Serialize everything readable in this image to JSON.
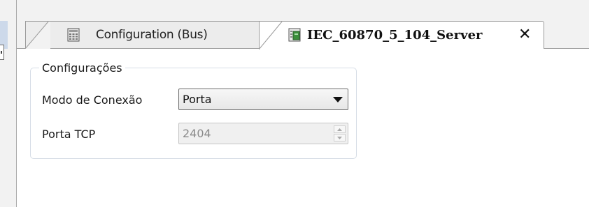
{
  "tabs": [
    {
      "label": "Configuration (Bus)",
      "icon": "device-config-icon",
      "active": false
    },
    {
      "label": "IEC_60870_5_104_Server",
      "icon": "server-object-icon",
      "active": true,
      "close": "✕"
    }
  ],
  "settings": {
    "group_title": "Configurações",
    "connection_mode": {
      "label": "Modo de Conexão",
      "value": "Porta"
    },
    "tcp_port": {
      "label": "Porta TCP",
      "value": "2404"
    }
  },
  "colors": {
    "tab_border": "#9b9b9b",
    "panel_border": "#d6dde6",
    "accent_green": "#3c8f3c"
  }
}
